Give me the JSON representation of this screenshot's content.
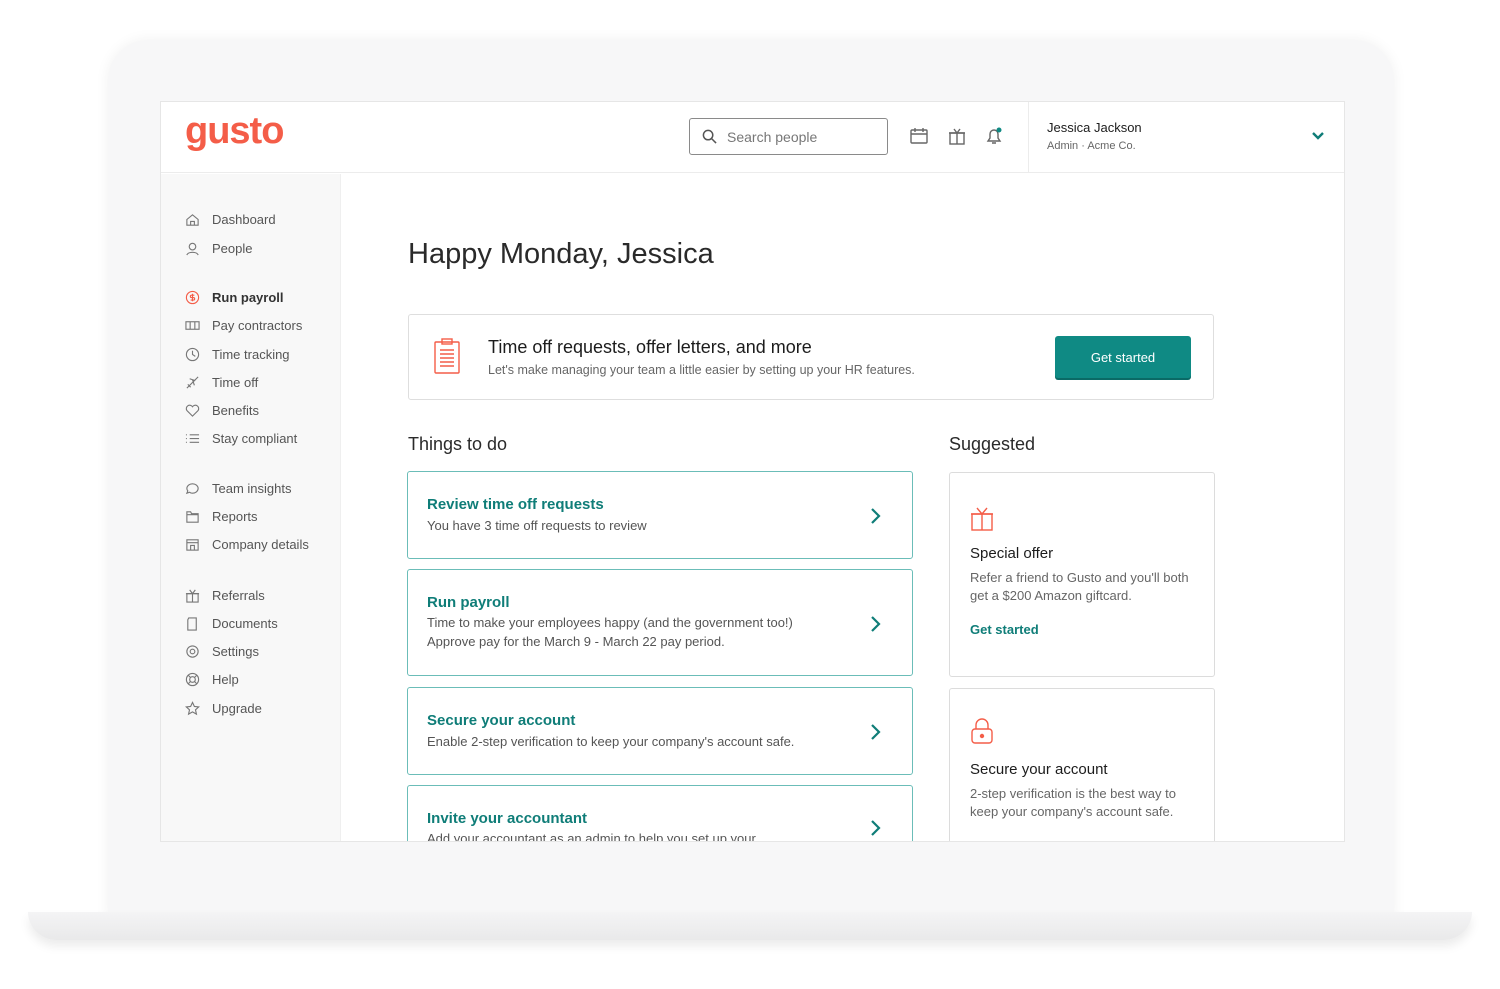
{
  "app": {
    "logo": "gusto",
    "brand_color": "#f45d48",
    "accent_color": "#0f8a84"
  },
  "header": {
    "search_placeholder": "Search people",
    "icons": [
      "calendar-icon",
      "gift-icon",
      "bell-icon"
    ],
    "user_name": "Jessica Jackson",
    "user_role": "Admin · Acme Co."
  },
  "sidebar": {
    "items": [
      {
        "label": "Dashboard",
        "icon": "home-icon"
      },
      {
        "label": "People",
        "icon": "people-icon"
      },
      {
        "label": "Run payroll",
        "icon": "dollar-icon",
        "active": true
      },
      {
        "label": "Pay contractors",
        "icon": "cash-icon"
      },
      {
        "label": "Time tracking",
        "icon": "clock-icon"
      },
      {
        "label": "Time off",
        "icon": "plane-icon"
      },
      {
        "label": "Benefits",
        "icon": "heart-icon"
      },
      {
        "label": "Stay compliant",
        "icon": "list-icon"
      },
      {
        "label": "Team insights",
        "icon": "chat-icon"
      },
      {
        "label": "Reports",
        "icon": "folder-icon"
      },
      {
        "label": "Company details",
        "icon": "building-icon"
      },
      {
        "label": "Referrals",
        "icon": "gift-icon"
      },
      {
        "label": "Documents",
        "icon": "document-icon"
      },
      {
        "label": "Settings",
        "icon": "gear-icon"
      },
      {
        "label": "Help",
        "icon": "lifebuoy-icon"
      },
      {
        "label": "Upgrade",
        "icon": "star-icon"
      }
    ]
  },
  "main": {
    "greeting": "Happy Monday, Jessica",
    "banner": {
      "title": "Time off requests, offer letters, and more",
      "subtitle": "Let's make managing your team a little easier by setting up your HR features.",
      "button": "Get started"
    },
    "todo_heading": "Things to do",
    "todos": [
      {
        "title": "Review time off requests",
        "desc": "You have 3 time off requests to review"
      },
      {
        "title": "Run payroll",
        "desc": "Time to make your employees happy (and the government too!) Approve pay for the March 9 - March 22 pay period."
      },
      {
        "title": "Secure your account",
        "desc": "Enable 2-step verification to keep your company's account safe."
      },
      {
        "title": "Invite your accountant",
        "desc": "Add your accountant as an admin to help you set up your"
      }
    ],
    "suggested_heading": "Suggested",
    "suggested": [
      {
        "title": "Special offer",
        "desc": "Refer a friend to Gusto and you'll both get a $200 Amazon giftcard.",
        "link": "Get started",
        "icon": "gift-icon"
      },
      {
        "title": "Secure your account",
        "desc": "2-step verification is the best way to keep your company's account safe.",
        "icon": "lock-icon"
      }
    ]
  }
}
